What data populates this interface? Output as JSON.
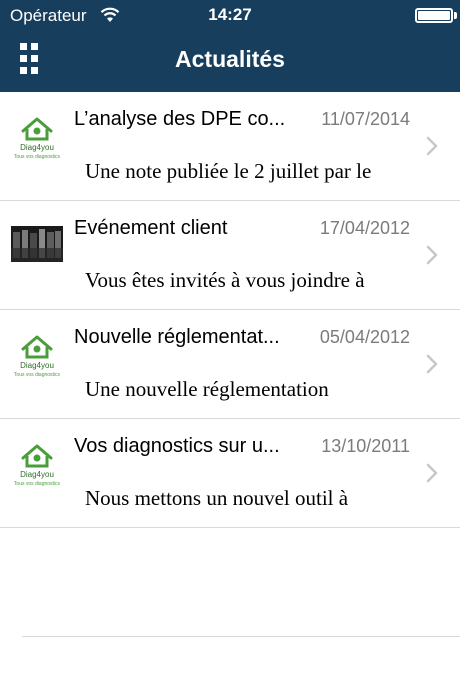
{
  "status_bar": {
    "carrier": "Opérateur",
    "time": "14:27"
  },
  "nav": {
    "title": "Actualités",
    "menu_icon": "grid-menu-icon"
  },
  "news": [
    {
      "title": "L’analyse des DPE co...",
      "date": "11/07/2014",
      "summary": "Une note publiée le 2 juillet par le",
      "thumb": "diag4you-logo",
      "logo_name": "Diag4you",
      "logo_tagline": "Tous vos diagnostics"
    },
    {
      "title": "Evénement client",
      "date": "17/04/2012",
      "summary": "Vous êtes invités à vous joindre à",
      "thumb": "photo"
    },
    {
      "title": "Nouvelle réglementat...",
      "date": "05/04/2012",
      "summary": "Une nouvelle réglementation",
      "thumb": "diag4you-logo",
      "logo_name": "Diag4you",
      "logo_tagline": "Tous vos diagnostics"
    },
    {
      "title": "Vos diagnostics sur u...",
      "date": "13/10/2011",
      "summary": "Nous mettons un nouvel outil à",
      "thumb": "diag4you-logo",
      "logo_name": "Diag4you",
      "logo_tagline": "Tous vos diagnostics"
    }
  ],
  "colors": {
    "nav_background": "#173e5c",
    "logo_green": "#4a9e3a",
    "date_gray": "#7b7b7b",
    "separator": "#d9d9d9"
  }
}
